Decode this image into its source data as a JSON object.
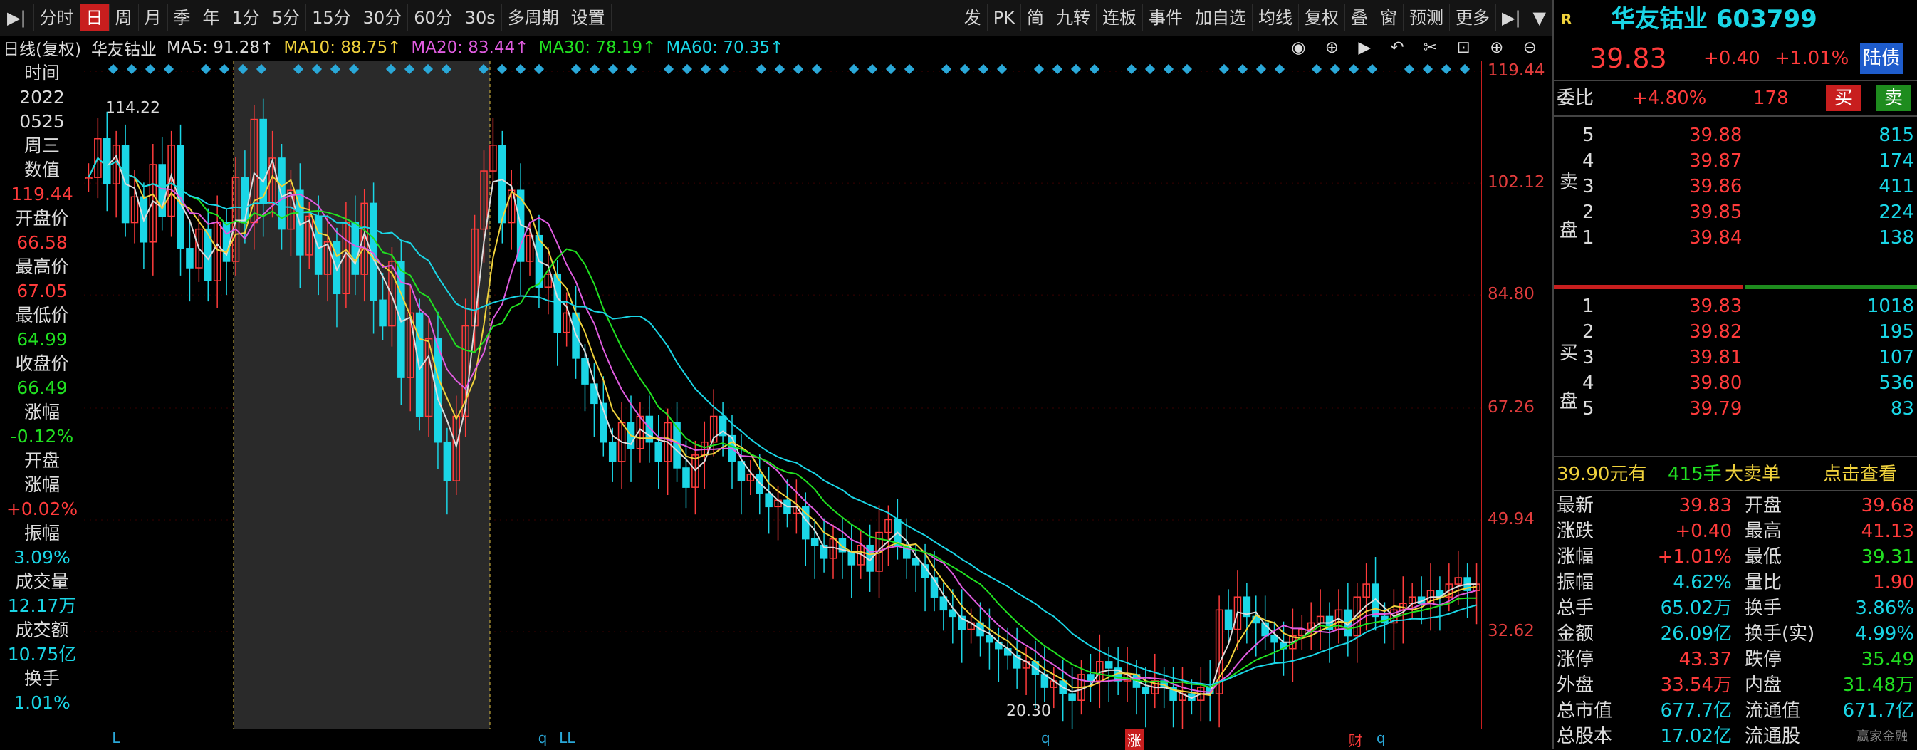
{
  "toolbar": {
    "left_items": [
      "分时",
      "日",
      "周",
      "月",
      "季",
      "年",
      "1分",
      "5分",
      "15分",
      "30分",
      "60分",
      "30s",
      "多周期",
      "设置"
    ],
    "active_index": 1,
    "right_items": [
      "发",
      "PK",
      "简",
      "九转",
      "连板",
      "事件",
      "加自选",
      "均线",
      "复权",
      "叠",
      "窗",
      "预测",
      "更多"
    ]
  },
  "ma_line": {
    "period": "日线(复权)",
    "stock_name": "华友钴业",
    "ma5": "MA5: 91.28↑",
    "ma10": "MA10: 88.75↑",
    "ma20": "MA20: 83.44↑",
    "ma30": "MA30: 78.19↑",
    "ma60": "MA60: 70.35↑"
  },
  "left_panel": [
    {
      "label": "时间",
      "color": "#dcdcdc"
    },
    {
      "label": "2022",
      "color": "#dcdcdc"
    },
    {
      "label": "0525",
      "color": "#dcdcdc"
    },
    {
      "label": "周三",
      "color": "#dcdcdc"
    },
    {
      "label": "数值",
      "color": "#dcdcdc"
    },
    {
      "label": "119.44",
      "color": "#ff3b3b"
    },
    {
      "label": "开盘价",
      "color": "#dcdcdc"
    },
    {
      "label": "66.58",
      "color": "#ff3b3b"
    },
    {
      "label": "最高价",
      "color": "#dcdcdc"
    },
    {
      "label": "67.05",
      "color": "#ff3b3b"
    },
    {
      "label": "最低价",
      "color": "#dcdcdc"
    },
    {
      "label": "64.99",
      "color": "#21e021"
    },
    {
      "label": "收盘价",
      "color": "#dcdcdc"
    },
    {
      "label": "66.49",
      "color": "#21e021"
    },
    {
      "label": "涨幅",
      "color": "#dcdcdc"
    },
    {
      "label": "-0.12%",
      "color": "#21e021"
    },
    {
      "label": "开盘",
      "color": "#dcdcdc"
    },
    {
      "label": "涨幅",
      "color": "#dcdcdc"
    },
    {
      "label": "+0.02%",
      "color": "#ff3b3b"
    },
    {
      "label": "振幅",
      "color": "#dcdcdc"
    },
    {
      "label": "3.09%",
      "color": "#1ad6e6"
    },
    {
      "label": "成交量",
      "color": "#dcdcdc"
    },
    {
      "label": "12.17万",
      "color": "#1ad6e6"
    },
    {
      "label": "成交额",
      "color": "#dcdcdc"
    },
    {
      "label": "10.75亿",
      "color": "#1ad6e6"
    },
    {
      "label": "换手",
      "color": "#dcdcdc"
    },
    {
      "label": "1.01%",
      "color": "#1ad6e6"
    }
  ],
  "chart_data": {
    "type": "candlestick",
    "y_ticks": [
      "119.44",
      "102.12",
      "84.80",
      "67.26",
      "49.94",
      "32.62"
    ],
    "ylim": [
      17.5,
      121
    ],
    "max_label": "114.22",
    "min_label": "20.30",
    "close_series": [
      103,
      109,
      102,
      108,
      96,
      100,
      93,
      105,
      97,
      108,
      92,
      89,
      95,
      87,
      96,
      90,
      103,
      96,
      112,
      99,
      106,
      95,
      101,
      91,
      97,
      88,
      93,
      85,
      96,
      88,
      99,
      84,
      80,
      90,
      72,
      82,
      66,
      78,
      62,
      56,
      66,
      80,
      95,
      104,
      108,
      96,
      101,
      90,
      94,
      86,
      88,
      79,
      82,
      75,
      71,
      68,
      62,
      59,
      65,
      61,
      66,
      62,
      59,
      65,
      58,
      55,
      60,
      62,
      66,
      63,
      59,
      56,
      57,
      54,
      52,
      53,
      51,
      52,
      47,
      46,
      44,
      47,
      45,
      43,
      46,
      42,
      48,
      50,
      46,
      44,
      43,
      41,
      38,
      36,
      35,
      33,
      34,
      32,
      31,
      30,
      29,
      27,
      28,
      26,
      24,
      25,
      23,
      22,
      26,
      25,
      28,
      27,
      25,
      26,
      24,
      23,
      25,
      24,
      22,
      23,
      22,
      24,
      23,
      36,
      33,
      38,
      35,
      34,
      32,
      31,
      30,
      32,
      33,
      34,
      35,
      33,
      36,
      32,
      38,
      40,
      35,
      34,
      36,
      37,
      38,
      37,
      39,
      38,
      40,
      41,
      39,
      40
    ],
    "bottom_markers": [
      {
        "text": "L",
        "x_frac": 0.02
      },
      {
        "text": "q",
        "x_frac": 0.325
      },
      {
        "text": "LL",
        "x_frac": 0.34
      },
      {
        "text": "q",
        "x_frac": 0.685
      },
      {
        "text": "涨",
        "x_frac": 0.745
      },
      {
        "text": "财",
        "x_frac": 0.905
      },
      {
        "text": "q",
        "x_frac": 0.925
      }
    ]
  },
  "right_panel": {
    "code": "R",
    "title": "华友钴业 603799",
    "price": "39.83",
    "change": "+0.40",
    "change_pct": "+1.01%",
    "badge": "陆债",
    "weibi_label": "委比",
    "weibi_pct": "+4.80%",
    "weibi_num": "178",
    "buy_btn": "买",
    "sell_btn": "卖",
    "sell_label": [
      "卖",
      "盘"
    ],
    "buy_label": [
      "买",
      "盘"
    ],
    "asks": [
      {
        "lvl": "5",
        "price": "39.88",
        "vol": "815"
      },
      {
        "lvl": "4",
        "price": "39.87",
        "vol": "174"
      },
      {
        "lvl": "3",
        "price": "39.86",
        "vol": "411"
      },
      {
        "lvl": "2",
        "price": "39.85",
        "vol": "224"
      },
      {
        "lvl": "1",
        "price": "39.84",
        "vol": "138"
      }
    ],
    "bids": [
      {
        "lvl": "1",
        "price": "39.83",
        "vol": "1018"
      },
      {
        "lvl": "2",
        "price": "39.82",
        "vol": "195"
      },
      {
        "lvl": "3",
        "price": "39.81",
        "vol": "107"
      },
      {
        "lvl": "4",
        "price": "39.80",
        "vol": "536"
      },
      {
        "lvl": "5",
        "price": "39.79",
        "vol": "83"
      }
    ],
    "big_order": {
      "price": "39.90元有",
      "lots": "415手",
      "label": "大卖单",
      "link": "点击查看"
    },
    "stats": [
      {
        "l1": "最新",
        "v1": "39.83",
        "c1": "#ff3b3b",
        "l2": "开盘",
        "v2": "39.68",
        "c2": "#ff3b3b"
      },
      {
        "l1": "涨跌",
        "v1": "+0.40",
        "c1": "#ff3b3b",
        "l2": "最高",
        "v2": "41.13",
        "c2": "#ff3b3b"
      },
      {
        "l1": "涨幅",
        "v1": "+1.01%",
        "c1": "#ff3b3b",
        "l2": "最低",
        "v2": "39.31",
        "c2": "#21e021"
      },
      {
        "l1": "振幅",
        "v1": "4.62%",
        "c1": "#1ad6e6",
        "l2": "量比",
        "v2": "1.90",
        "c2": "#ff3b3b"
      },
      {
        "l1": "总手",
        "v1": "65.02万",
        "c1": "#1ad6e6",
        "l2": "换手",
        "v2": "3.86%",
        "c2": "#1ad6e6"
      },
      {
        "l1": "金额",
        "v1": "26.09亿",
        "c1": "#1ad6e6",
        "l2": "换手(实)",
        "v2": "4.99%",
        "c2": "#1ad6e6"
      },
      {
        "l1": "涨停",
        "v1": "43.37",
        "c1": "#ff3b3b",
        "l2": "跌停",
        "v2": "35.49",
        "c2": "#21e021"
      },
      {
        "l1": "外盘",
        "v1": "33.54万",
        "c1": "#ff3b3b",
        "l2": "内盘",
        "v2": "31.48万",
        "c2": "#21e021"
      },
      {
        "l1": "总市值",
        "v1": "677.7亿",
        "c1": "#1ad6e6",
        "l2": "流通值",
        "v2": "671.7亿",
        "c2": "#1ad6e6"
      },
      {
        "l1": "总股本",
        "v1": "17.02亿",
        "c1": "#1ad6e6",
        "l2": "流通股",
        "v2": "",
        "c2": "#1ad6e6"
      }
    ],
    "watermark": "赢家金融"
  }
}
